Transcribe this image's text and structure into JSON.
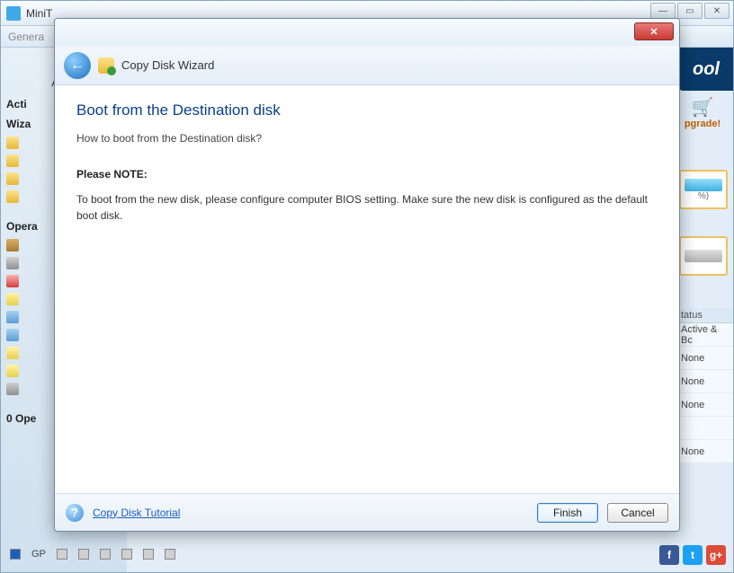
{
  "parent": {
    "title_prefix": "MiniT",
    "menubar_item": "Genera",
    "brand_fragment": "ool",
    "apply_label": "Apply",
    "upgrade_label": "pgrade!",
    "percent_fragment": "%)",
    "sections": {
      "actions": "Acti",
      "wizards": "Wiza",
      "operations": "Opera",
      "pending": "0 Ope"
    },
    "table": {
      "header": "tatus",
      "rows": [
        "Active & Bc",
        "None",
        "None",
        "None",
        "",
        "None"
      ]
    },
    "legend_first": "GP",
    "social": {
      "fb": "f",
      "tw": "t",
      "gp": "g+"
    }
  },
  "wizard": {
    "close_glyph": "✕",
    "back_glyph": "←",
    "title": "Copy Disk Wizard",
    "heading": "Boot from the Destination disk",
    "subheading": "How to boot from the Destination disk?",
    "note_label": "Please NOTE:",
    "note_text": "To boot from the new disk, please configure computer BIOS setting. Make sure the new disk is configured as the default boot disk.",
    "tutorial_link": "Copy Disk Tutorial",
    "finish_label": "Finish",
    "cancel_label": "Cancel",
    "help_glyph": "?"
  }
}
